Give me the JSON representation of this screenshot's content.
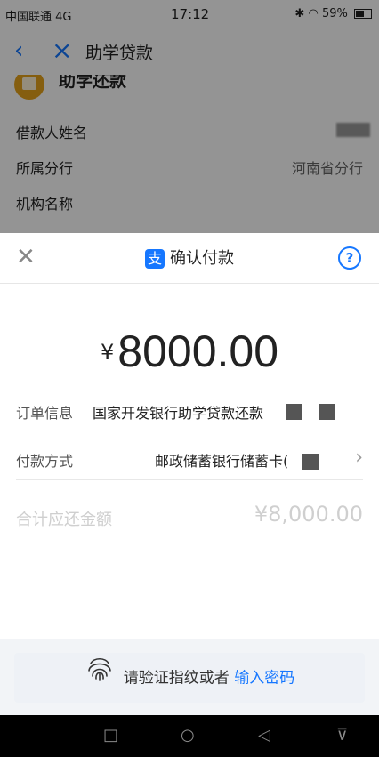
{
  "status_bar": {
    "signal": "⁴ᴳ|||",
    "carrier": "中国联通 4G",
    "time": "17:12",
    "battery": "59%",
    "battery_level": 0.59
  },
  "nav": {
    "title": "助学贷款"
  },
  "loan": {
    "name": "助学还款"
  },
  "info_rows": [
    {
      "label": "借款人姓名",
      "value": ""
    },
    {
      "label": "所属分行",
      "value": "河南省分行"
    },
    {
      "label": "机构名称",
      "value": ""
    }
  ],
  "sheet": {
    "title": "确认付款",
    "logo_char": "支",
    "help": "?",
    "amount_symbol": "¥",
    "amount": "8000.00",
    "order_label": "订单信息",
    "order_value": "国家开发银行助学贷款还款",
    "payment_label": "付款方式",
    "payment_value": "邮政储蓄银行储蓄卡(",
    "behind_total_label": "合计应还金额",
    "behind_total_value": "¥8,000.00"
  },
  "verify": {
    "prompt": "请验证指纹或者",
    "link": "输入密码"
  },
  "colors": {
    "accent": "#1677ff",
    "logo": "#e6a21a"
  }
}
